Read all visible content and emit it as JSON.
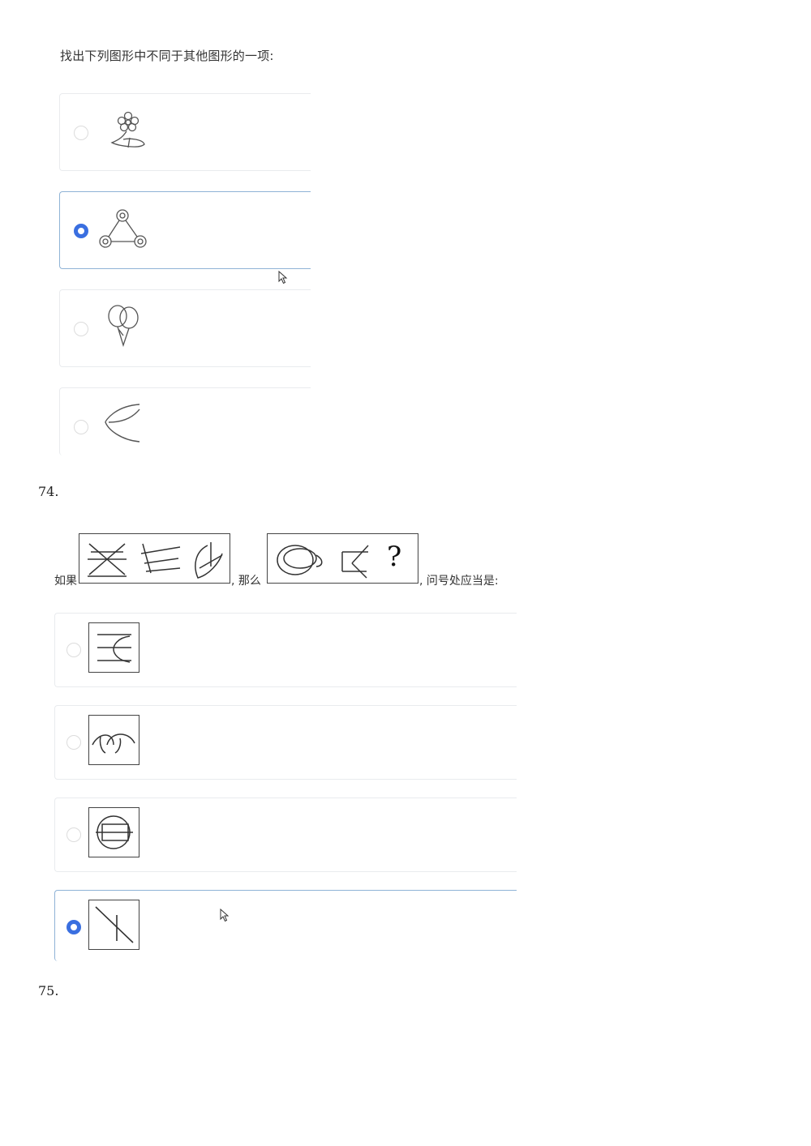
{
  "q73": {
    "title": "找出下列图形中不同于其他图形的一项:",
    "options": [
      {
        "figure": "flower-on-leaf",
        "selected": false
      },
      {
        "figure": "three-rings-triangle",
        "selected": true
      },
      {
        "figure": "balloons",
        "selected": false
      },
      {
        "figure": "crescent-arcs",
        "selected": false
      }
    ]
  },
  "q74": {
    "number": "74.",
    "prompt_prefix": "如果",
    "prompt_middle": ", 那么",
    "prompt_suffix": ", 问号处应当是:",
    "question_mark": "?",
    "options": [
      {
        "figure": "lines-with-arc-box",
        "selected": false
      },
      {
        "figure": "three-arcs-box",
        "selected": false
      },
      {
        "figure": "circle-with-rectangle-box",
        "selected": false
      },
      {
        "figure": "diagonal-line-box",
        "selected": true
      }
    ]
  },
  "q75": {
    "number": "75."
  },
  "colors": {
    "radio_selected": "#3a6fe0",
    "card_border": "#e9ebee",
    "card_selected_border": "#8fb3d6"
  }
}
